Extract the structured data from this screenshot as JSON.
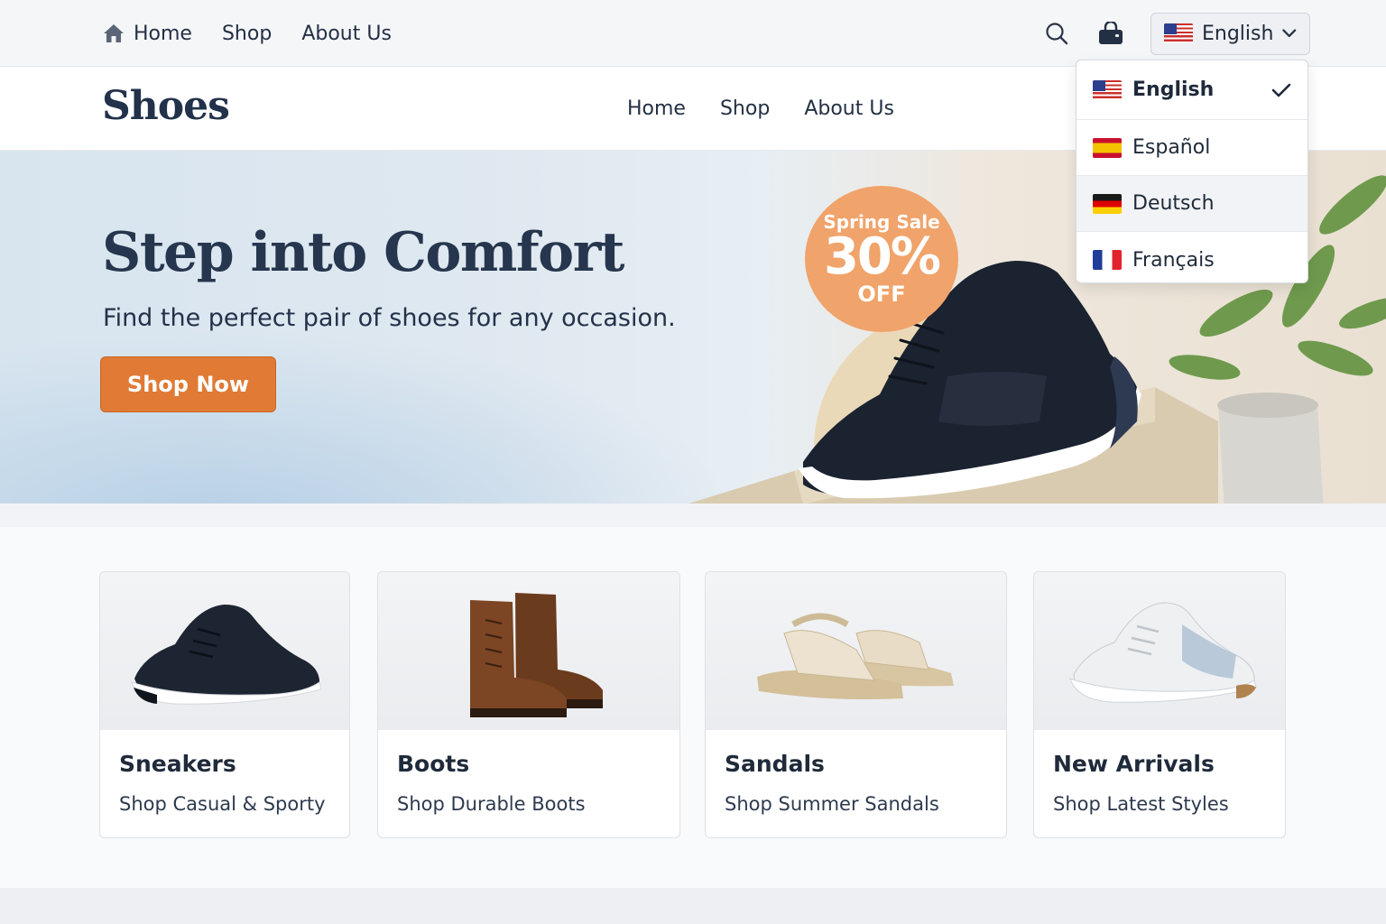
{
  "topbar": {
    "nav": [
      {
        "label": "Home",
        "icon": "home-icon"
      },
      {
        "label": "Shop"
      },
      {
        "label": "About Us"
      }
    ],
    "search_icon": "search-icon",
    "cart_icon": "bag-icon",
    "language": {
      "selected": "English",
      "flag": "us-flag-icon"
    }
  },
  "header": {
    "brand": "Shoes",
    "nav": [
      "Home",
      "Shop",
      "About Us"
    ]
  },
  "hero": {
    "title": "Step into Comfort",
    "subtitle": "Find the perfect pair of shoes for any occasion.",
    "cta": "Shop Now",
    "badge": {
      "line1": "Spring Sale",
      "line2": "30%",
      "line3": "OFF"
    }
  },
  "language_menu": {
    "items": [
      {
        "label": "English",
        "flag": "us-flag-icon",
        "selected": true
      },
      {
        "label": "Español",
        "flag": "es-flag-icon",
        "selected": false
      },
      {
        "label": "Deutsch",
        "flag": "de-flag-icon",
        "selected": false
      },
      {
        "label": "Français",
        "flag": "fr-flag-icon",
        "selected": false
      }
    ]
  },
  "categories": [
    {
      "title": "Sneakers",
      "subtitle": "Shop Casual & Sporty"
    },
    {
      "title": "Boots",
      "subtitle": "Shop Durable Boots"
    },
    {
      "title": "Sandals",
      "subtitle": "Shop Summer Sandals"
    },
    {
      "title": "New Arrivals",
      "subtitle": "Shop Latest Styles"
    }
  ],
  "colors": {
    "accent": "#e07a35",
    "badge": "#f0a36a",
    "text_dark": "#22324a"
  }
}
